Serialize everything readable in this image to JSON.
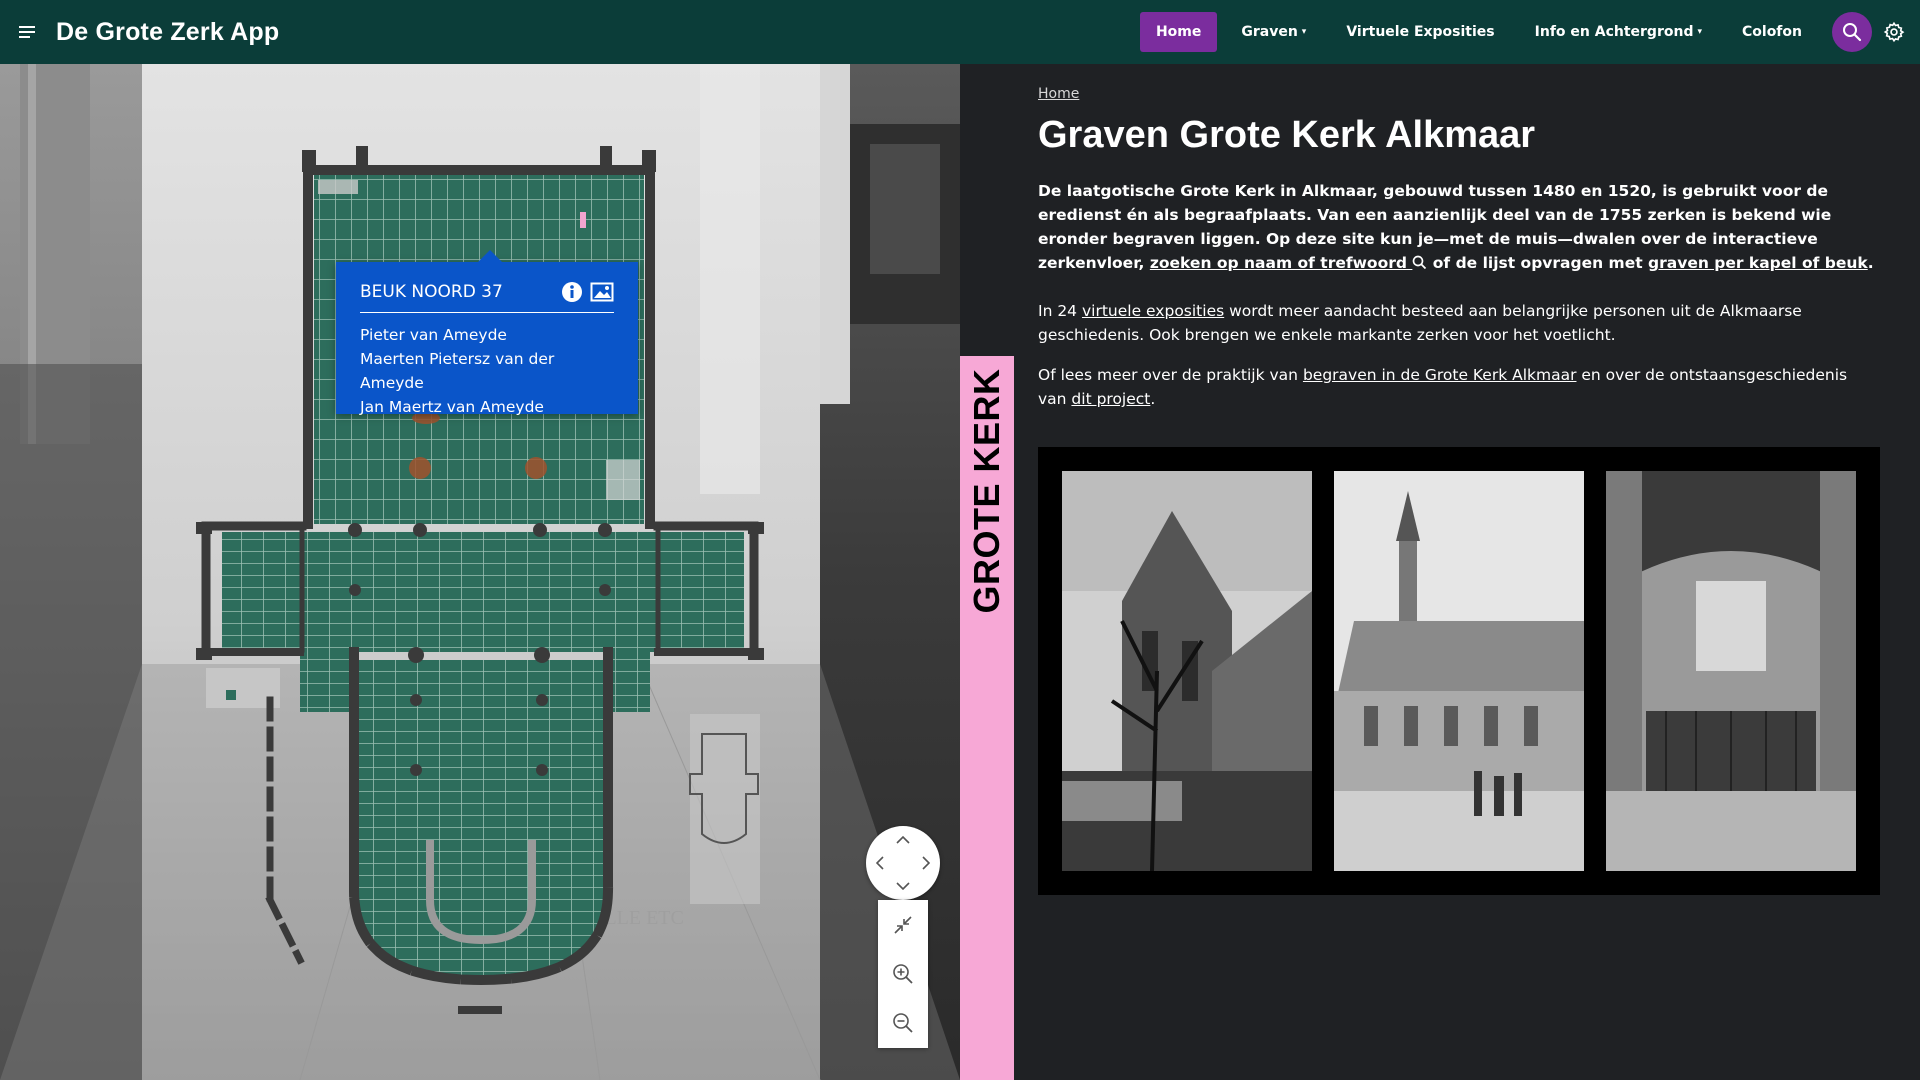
{
  "app": {
    "title": "De Grote Zerk App"
  },
  "icons": {
    "menu": "menu-icon",
    "search": "search-icon",
    "settings": "gear-icon",
    "info": "info-icon",
    "image": "image-icon",
    "collapse": "collapse-icon",
    "zoom_in": "zoom-in-icon",
    "zoom_out": "zoom-out-icon"
  },
  "colors": {
    "header_bg": "#0b3d39",
    "accent_purple": "#7b2d9e",
    "tooltip_blue": "#0a55c9",
    "floor_green": "#2d6d5c",
    "side_label_pink": "#f7a8d6",
    "page_bg": "#1f2124"
  },
  "nav": {
    "home": "Home",
    "graven": "Graven",
    "virtuele_exposities": "Virtuele Exposities",
    "info": "Info en Achtergrond",
    "colofon": "Colofon",
    "chevron": "⌄"
  },
  "map": {
    "tooltip": {
      "title": "BEUK NOORD 37",
      "names": [
        "Pieter van Ameyde",
        "Maerten Pietersz van der Ameyde",
        "Jan Maertz van Ameyde"
      ]
    },
    "controls": {
      "up": "⌃",
      "down": "⌄",
      "left": "‹",
      "right": "›"
    }
  },
  "side_label": "GROTE KERK",
  "content": {
    "breadcrumb": "Home",
    "title": "Graven Grote Kerk Alkmaar",
    "intro": {
      "t1": "De laatgotische Grote Kerk in Alkmaar, gebouwd tussen 1480 en 1520, is gebruikt voor de eredienst én als begraafplaats. Van een aanzienlijk deel van de 1755 zerken is bekend wie eronder begraven liggen. Op deze site kun je—met de muis—dwalen over de interactieve zerkenvloer, ",
      "link1": "zoeken op naam of trefwoord",
      "t2": " of de lijst opvragen met ",
      "link2": "graven per kapel of beuk",
      "t3": "."
    },
    "para2": {
      "t1": "In 24 ",
      "link": "virtuele exposities",
      "t2": " wordt meer aandacht besteed aan belangrijke personen uit de Alkmaarse geschiedenis. Ook brengen we enkele markante zerken voor het voetlicht."
    },
    "para3": {
      "t1": "Of lees meer over de praktijk van ",
      "link1": "begraven in de Grote Kerk Alkmaar",
      "t2": " en over de ontstaansgeschiedenis van ",
      "link2": "dit project",
      "t3": "."
    }
  }
}
